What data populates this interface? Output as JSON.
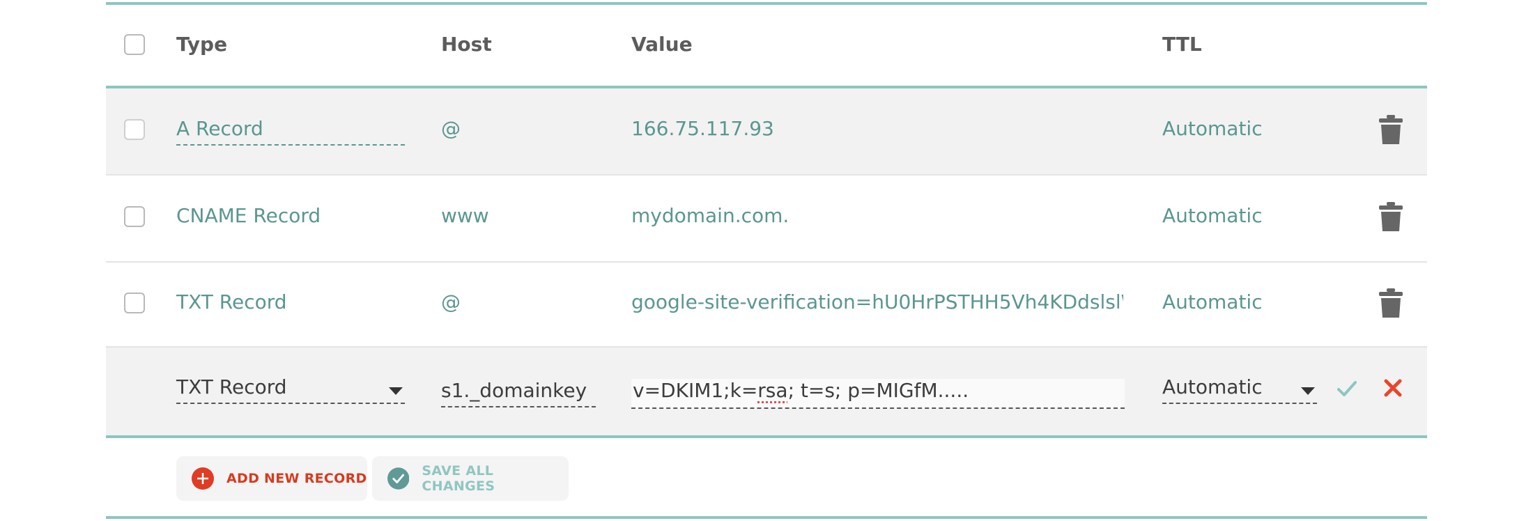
{
  "columns": {
    "type": "Type",
    "host": "Host",
    "value": "Value",
    "ttl": "TTL"
  },
  "records": [
    {
      "type": "A Record",
      "host": "@",
      "value": "166.75.117.93",
      "ttl": "Automatic"
    },
    {
      "type": "CNAME Record",
      "host": "www",
      "value": "mydomain.com.",
      "ttl": "Automatic"
    },
    {
      "type": "TXT Record",
      "host": "@",
      "value": "google-site-verification=hU0HrPSTHH5Vh4KDdslslW…",
      "ttl": "Automatic"
    }
  ],
  "edit_row": {
    "type": "TXT Record",
    "host": "s1._domainkey",
    "value_pre": "v=DKIM1;k=",
    "value_misspelled": "rsa",
    "value_post": "; t=s; p=MIGfM.....",
    "ttl": "Automatic"
  },
  "buttons": {
    "add_label": "ADD NEW RECORD",
    "save_label": "SAVE ALL CHANGES"
  },
  "colors": {
    "accent": "#8cc6c1",
    "link": "#5a9690",
    "danger": "#e8462a",
    "confirm": "#8cc6c1"
  }
}
